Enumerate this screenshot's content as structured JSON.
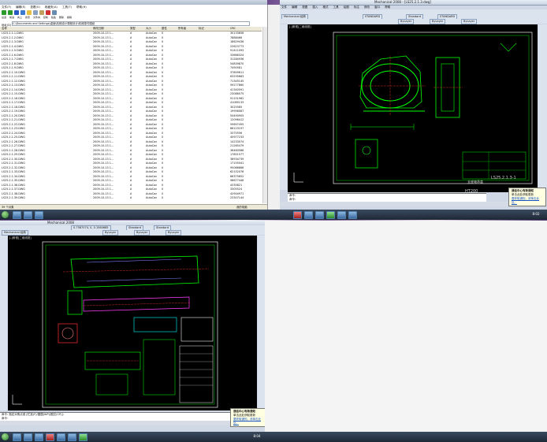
{
  "explorer": {
    "menu": [
      "文件(F)",
      "编辑(E)",
      "查看(V)",
      "收藏夹(A)",
      "工具(T)",
      "帮助(H)"
    ],
    "toolbar_labels": [
      "后退",
      "前进",
      "向上",
      "搜索",
      "文件夹",
      "复制",
      "粘贴",
      "删除",
      "撤销"
    ],
    "address_label": "地址(D)",
    "address": "C:\\Documents and Settings\\桌面\\机械设计课程设计\\机械零件图纸",
    "columns": [
      "名称",
      "修改日期",
      "类型",
      "大小",
      "属性",
      "所有者",
      "标记",
      "CRC"
    ],
    "rows": [
      [
        "LS25.2.1.1.DWG",
        "2009-10-13 1...",
        "A",
        "AutoCad",
        "0",
        "30133656"
      ],
      [
        "LS25.2.1.2.DWG",
        "2009-10-13 1...",
        "A",
        "AutoCad",
        "0",
        "7888466"
      ],
      [
        "LS25.2.1.3.DWG",
        "2009-10-13 1...",
        "A",
        "AutoCad",
        "0",
        "18629436"
      ],
      [
        "LS25.2.1.4.DWG",
        "2009-10-13 1...",
        "A",
        "AutoCad",
        "0",
        "22623773"
      ],
      [
        "LS25.2.1.5.DWG",
        "2009-10-13 1...",
        "A",
        "AutoCad",
        "0",
        "91411093"
      ],
      [
        "LS25.2.1.6.DWG",
        "2009-10-13 1...",
        "A",
        "AutoCad",
        "0",
        "33666324"
      ],
      [
        "LS25.2.1.7.DWG",
        "2009-10-13 1...",
        "A",
        "AutoCad",
        "0",
        "31284936"
      ],
      [
        "LS25.2.1.8.DWG",
        "2009-10-13 1...",
        "A",
        "AutoCad",
        "0",
        "54839870"
      ],
      [
        "LS25.2.1.9.DWG",
        "2009-10-13 1...",
        "A",
        "AutoCad",
        "0",
        "7490581"
      ],
      [
        "LS25.2.1.10.DWG",
        "2009-10-13 1...",
        "A",
        "AutoCad",
        "0",
        "37809611"
      ],
      [
        "LS25.2.1.11.DWG",
        "2009-10-13 1...",
        "A",
        "AutoCad",
        "0",
        "63295663"
      ],
      [
        "LS25.2.1.12.DWG",
        "2009-10-13 1...",
        "A",
        "AutoCad",
        "0",
        "71345145"
      ],
      [
        "LS25.2.1.13.DWG",
        "2009-10-13 1...",
        "A",
        "AutoCad",
        "0",
        "59277860"
      ],
      [
        "LS25.2.1.14.DWG",
        "2009-10-13 1...",
        "A",
        "AutoCad",
        "0",
        "41340591"
      ],
      [
        "LS25.2.1.15.DWG",
        "2009-10-13 1...",
        "A",
        "AutoCad",
        "0",
        "23086075"
      ],
      [
        "LS25.2.1.16.DWG",
        "2009-10-13 1...",
        "A",
        "AutoCad",
        "0",
        "91151962"
      ],
      [
        "LS25.2.1.17.DWG",
        "2009-10-13 1...",
        "A",
        "AutoCad",
        "0",
        "41085133"
      ],
      [
        "LS25.2.1.18.DWG",
        "2009-10-13 1...",
        "A",
        "AutoCad",
        "0",
        "3025585"
      ],
      [
        "LS25.2.1.19.DWG",
        "2009-10-13 1...",
        "A",
        "AutoCad",
        "0",
        "19956087"
      ],
      [
        "LS25.2.1.20.DWG",
        "2009-10-13 1...",
        "A",
        "AutoCad",
        "0",
        "54490905"
      ],
      [
        "LS25.2.1.21.DWG",
        "2009-10-13 1...",
        "A",
        "AutoCad",
        "0",
        "12096412"
      ],
      [
        "LS25.2.1.22.DWG",
        "2009-10-13 1...",
        "A",
        "AutoCad",
        "0",
        "59697495"
      ],
      [
        "LS25.2.1.23.DWG",
        "2009-10-13 1...",
        "A",
        "AutoCad",
        "0",
        "86123197"
      ],
      [
        "LS25.2.1.24.DWG",
        "2009-10-13 1...",
        "A",
        "AutoCad",
        "0",
        "3375556"
      ],
      [
        "LS25.2.1.25.DWG",
        "2009-10-13 1...",
        "A",
        "AutoCad",
        "0",
        "40977233"
      ],
      [
        "LS25.2.1.26.DWG",
        "2009-10-13 1...",
        "A",
        "AutoCad",
        "0",
        "14233074"
      ],
      [
        "LS25.2.1.27.DWG",
        "2009-10-13 1...",
        "A",
        "AutoCad",
        "0",
        "21265479"
      ],
      [
        "LS25.2.1.28.DWG",
        "2009-10-13 1...",
        "A",
        "AutoCad",
        "0",
        "36460586"
      ],
      [
        "LS25.2.1.29.DWG",
        "2009-10-13 1...",
        "A",
        "AutoCad",
        "0",
        "17851577"
      ],
      [
        "LS25.2.1.30.DWG",
        "2009-10-13 1...",
        "A",
        "AutoCad",
        "0",
        "38934739"
      ],
      [
        "LS25.2.1.31.DWG",
        "2009-10-13 1...",
        "A",
        "AutoCad",
        "0",
        "17155041"
      ],
      [
        "LS25.2.1.32.DWG",
        "2009-10-13 1...",
        "A",
        "AutoCad",
        "0",
        "95066866"
      ],
      [
        "LS25.2.1.33.DWG",
        "2009-10-13 1...",
        "A",
        "AutoCad",
        "0",
        "62152076"
      ],
      [
        "LS25.2.1.34.DWG",
        "2009-10-13 1...",
        "A",
        "AutoCad",
        "0",
        "66375652"
      ],
      [
        "LS25.2.1.35.DWG",
        "2009-10-13 1...",
        "A",
        "AutoCad",
        "0",
        "98677446"
      ],
      [
        "LS25.2.1.36.DWG",
        "2009-10-13 1...",
        "A",
        "AutoCad",
        "0",
        "4335821"
      ],
      [
        "LS25.2.1.37.DWG",
        "2009-10-13 1...",
        "A",
        "AutoCad",
        "0",
        "3305524"
      ],
      [
        "LS25.2.1.38.DWG",
        "2009-10-13 1...",
        "A",
        "AutoCad",
        "0",
        "42904971"
      ],
      [
        "LS25.2.1.39.DWG",
        "2009-10-13 1...",
        "A",
        "AutoCad",
        "0",
        "23307144"
      ]
    ],
    "status_left": "39 个对象",
    "status_right": "我的电脑"
  },
  "cad_right": {
    "title": "Mechanical 2008 - [LS25.2.1.3.dwg]",
    "menu": [
      "文件",
      "编辑",
      "视图",
      "插入",
      "格式",
      "工具",
      "绘图",
      "标注",
      "修改",
      "窗口",
      "帮助"
    ],
    "workspace": "Mechanical 经典",
    "style1": "STANDARD",
    "style2": "Standard",
    "style3": "STANDARD",
    "layer_bar": [
      "ByLayer",
      "ByLayer",
      "ByLayer"
    ],
    "doc_tab": "[-]俯视[二维线框]",
    "title_block_no": "LS25.2.1.3-1",
    "title_block_name": "支座轴承盖",
    "material": "HT200",
    "cmd_lines": [
      "命令:",
      "命令:"
    ],
    "notify_title": "通信中心有新通知",
    "notify_text": "单击此处获取更新",
    "notify_link": "要获取通知，请单击此处。",
    "clock": "8:02"
  },
  "cad_left": {
    "title": "Mechanical 2008",
    "workspace": "Mechanical 经典",
    "coords": "0.7587074, 0, 0.1560685",
    "style1": "Standard",
    "style2": "Standard",
    "layer_bar": [
      "ByLayer",
      "ByLayer",
      "ByLayer"
    ],
    "doc_tab": "[-]俯视[二维线框]",
    "cmd_lines": [
      "命令: 指定对角点或 [栏选(F)/圈围(WP)/圈交(CP)]:",
      "命令:"
    ],
    "notify_title": "通信中心有新通知",
    "notify_text": "单击此处获取更新",
    "notify_link": "要获取通知，请单击此处。",
    "clock": "8:04"
  }
}
